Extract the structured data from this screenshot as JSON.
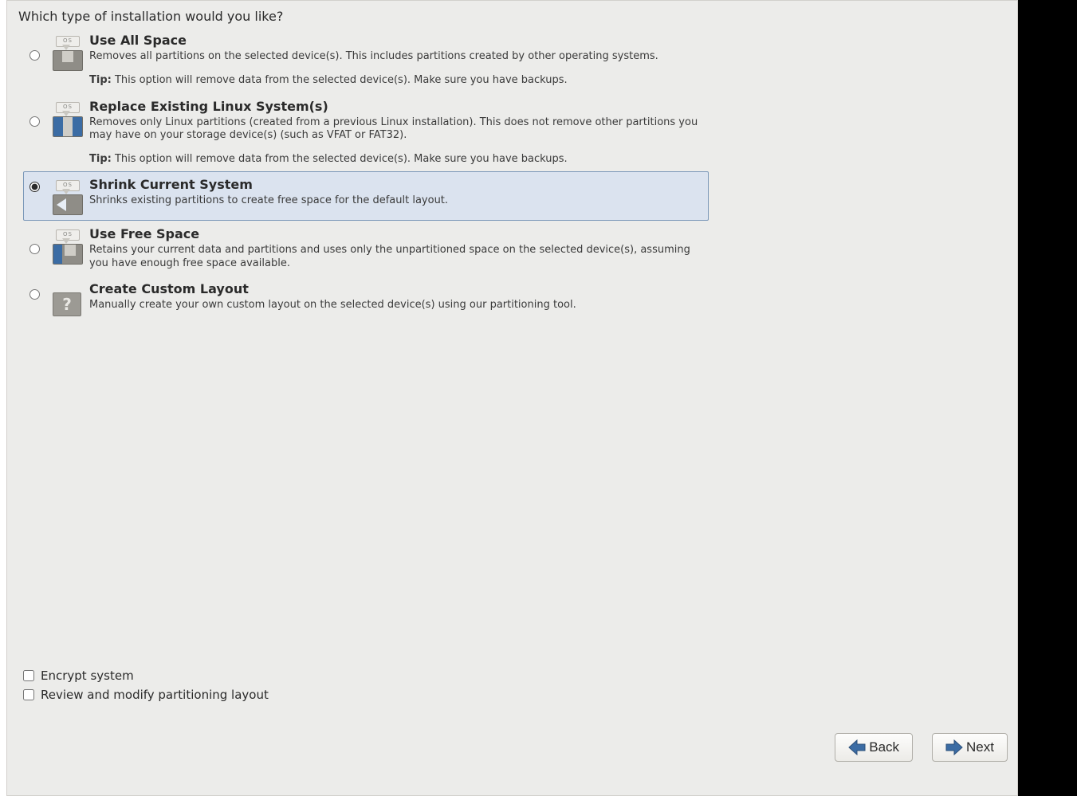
{
  "heading": "Which type of installation would you like?",
  "selected_index": 2,
  "tip_label": "Tip:",
  "os_tab_label": "OS",
  "options": [
    {
      "id": "use-all-space",
      "title": "Use All Space",
      "desc": "Removes all partitions on the selected device(s).  This includes partitions created by other operating systems.",
      "tip": "This option will remove data from the selected device(s).  Make sure you have backups."
    },
    {
      "id": "replace-linux",
      "title": "Replace Existing Linux System(s)",
      "desc": "Removes only Linux partitions (created from a previous Linux installation).  This does not remove other partitions you may have on your storage device(s) (such as VFAT or FAT32).",
      "tip": "This option will remove data from the selected device(s).  Make sure you have backups."
    },
    {
      "id": "shrink",
      "title": "Shrink Current System",
      "desc": "Shrinks existing partitions to create free space for the default layout."
    },
    {
      "id": "use-free-space",
      "title": "Use Free Space",
      "desc": "Retains your current data and partitions and uses only the unpartitioned space on the selected device(s), assuming you have enough free space available."
    },
    {
      "id": "custom-layout",
      "title": "Create Custom Layout",
      "desc": "Manually create your own custom layout on the selected device(s) using our partitioning tool."
    }
  ],
  "checkboxes": {
    "encrypt": {
      "label": "Encrypt system",
      "checked": false
    },
    "review": {
      "label": "Review and modify partitioning layout",
      "checked": false
    }
  },
  "buttons": {
    "back": "Back",
    "next": "Next"
  }
}
